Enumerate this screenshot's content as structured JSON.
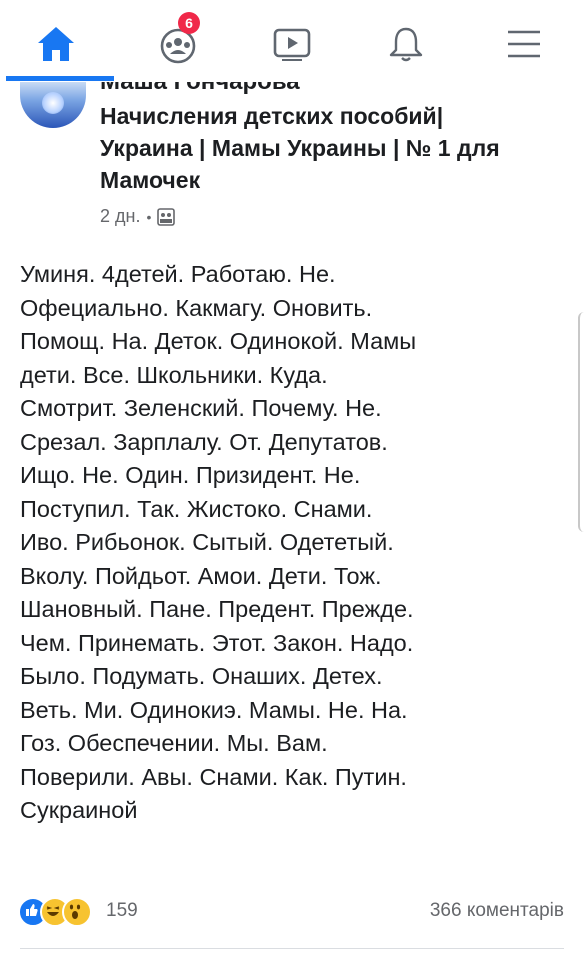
{
  "nav": {
    "items": [
      {
        "icon": "home-icon",
        "active": true
      },
      {
        "icon": "groups-icon",
        "badge": "6"
      },
      {
        "icon": "watch-icon"
      },
      {
        "icon": "bell-icon"
      },
      {
        "icon": "menu-icon"
      }
    ],
    "accent": "#1877f2",
    "badge_color": "#f02849"
  },
  "post": {
    "author_partial": "Маша Гончарова",
    "group_title": "Начисления детских пособий| Украина | Мамы Украины | № 1 для Мамочек",
    "time": "2 дн.",
    "privacy_icon": "group-icon",
    "text": "Уминя. 4детей. Работаю.  Не.\nОфециально.  Какмагу.  Оновить.\nПомощ. На. Деток.     Одинокой. Мамы\nдети.   Все. Школьники.        Куда.\nСмотрит. Зеленский.    Почему.  Не.\nСрезал.  Зарплалу. От. Депутатов.\nИщо.    Не. Один.  Призидент.  Не.\nПоступил.    Так.  Жистоко.  Снами.\nИво. Рибьонок.  Сытый.  Одететый.\nВколу.  Пойдьот.  Амои.  Дети.     Тож.\nШановный.   Пане. Предент. Прежде.\nЧем. Принемать. Этот.  Закон.     Надо.\nБыло. Подумать.  Онаших. Детех.\nВеть. Ми. Одинокиэ.     Мамы. Не. На.\nГоз.  Обеспечении.  Мы.  Вам.\nПоверили.   Авы.  Снами.   Как. Путин.\nСукраиной",
    "reactions": {
      "icons": [
        "like-icon",
        "haha-icon",
        "wow-icon"
      ],
      "count": "159"
    },
    "comments": "366 коментарів"
  }
}
